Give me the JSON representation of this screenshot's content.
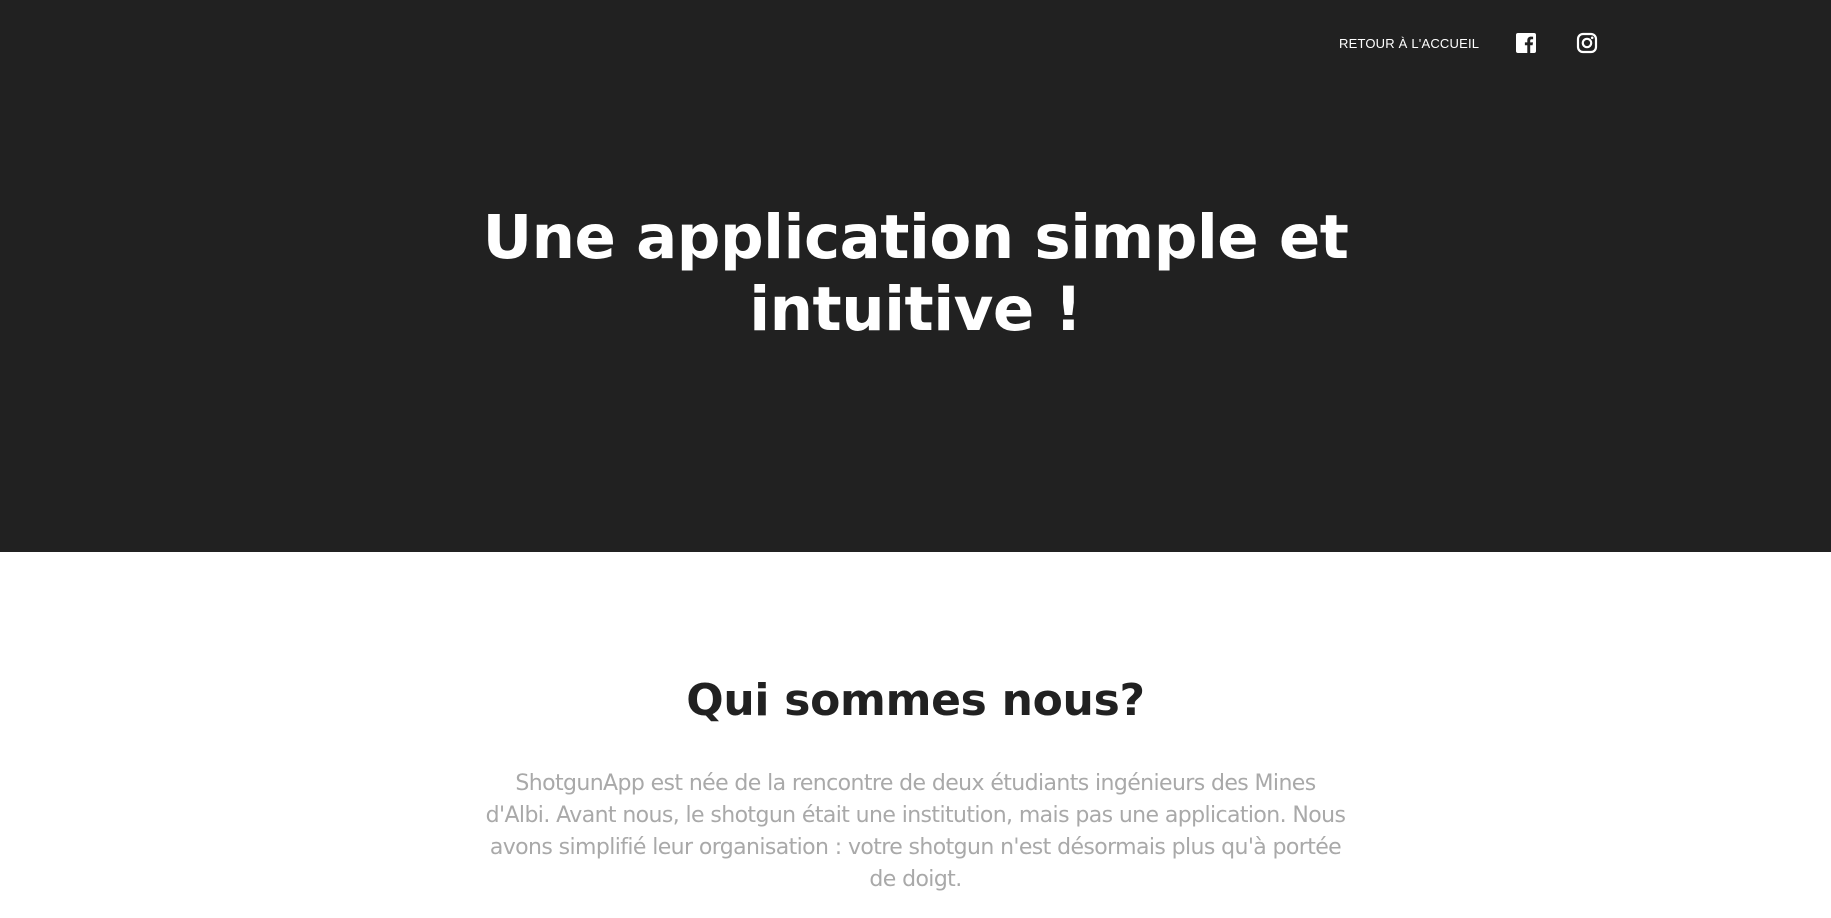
{
  "nav": {
    "home_link": "RETOUR À L'ACCUEIL",
    "icons": [
      "facebook-icon",
      "instagram-icon"
    ]
  },
  "hero": {
    "title_line1": "Une application simple et",
    "title_line2": "intuitive !"
  },
  "about": {
    "heading": "Qui sommes nous?",
    "text_lines": [
      "ShotgunApp est née de la rencontre de deux étudiants ingénieurs des Mines",
      "d'Albi. Avant nous, le shotgun était une institution, mais pas une application. Nous",
      "avons simplifié leur organisation : votre shotgun n'est désormais plus qu'à portée",
      "de doigt."
    ]
  },
  "colors": {
    "hero_background": "#212121",
    "hero_text": "#ffffff",
    "heading_text": "#212121",
    "body_text": "#a9a9a9"
  }
}
